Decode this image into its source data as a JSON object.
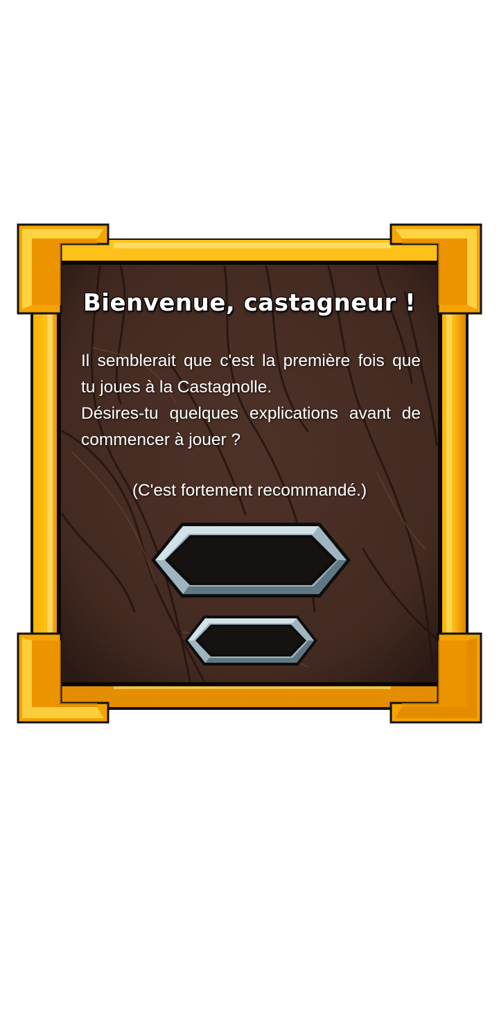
{
  "dialog": {
    "title": "Bienvenue, castagneur !",
    "message_lines": [
      "Il semblerait que c'est la première fois que",
      "tu joues à la Castagnolle.",
      "Désires-tu quelques explications avant de",
      "commencer à jouer ?"
    ],
    "note": "(C'est fortement recommandé.)",
    "primary_button_label": "",
    "secondary_button_label": ""
  },
  "colors": {
    "frame_gold": "#f5a300",
    "frame_gold_dark": "#d47000",
    "frame_highlight": "#ffd84a",
    "wood": "#482e25",
    "wood_dark": "#2a1812",
    "button_steel": "#9fb6c0",
    "button_steel_dark": "#5f7780",
    "text": "#ffffff"
  },
  "icons": {
    "primary_button_shape": "hexagon-frame-icon",
    "secondary_button_shape": "hexagon-frame-icon"
  }
}
